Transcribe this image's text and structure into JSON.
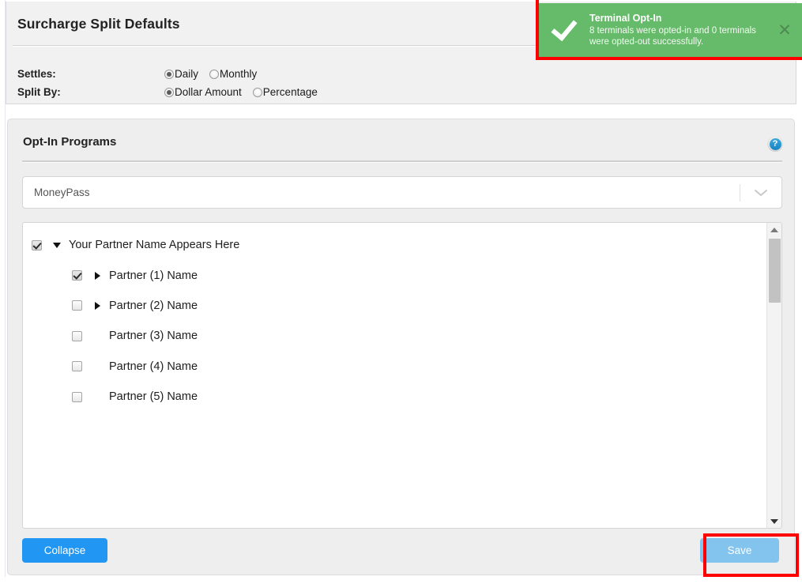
{
  "header": {
    "title": "Surcharge Split Defaults",
    "rows": [
      {
        "label": "Settles:",
        "options": [
          {
            "label": "Daily",
            "checked": true
          },
          {
            "label": "Monthly",
            "checked": false
          }
        ]
      },
      {
        "label": "Split By:",
        "options": [
          {
            "label": "Dollar Amount",
            "checked": true
          },
          {
            "label": "Percentage",
            "checked": false
          }
        ]
      }
    ]
  },
  "card": {
    "title": "Opt-In Programs",
    "help_icon": "help-circle-icon",
    "help_glyph": "?",
    "program_select": {
      "value": "MoneyPass",
      "caret_icon": "chevron-down-icon"
    },
    "tree": [
      {
        "label": "Your Partner Name Appears Here",
        "level": 0,
        "checked": true,
        "arrow": "down",
        "arrow_icon": "triangle-down-icon"
      },
      {
        "label": "Partner (1) Name",
        "level": 1,
        "checked": true,
        "arrow": "right",
        "arrow_icon": "triangle-right-icon"
      },
      {
        "label": "Partner (2) Name",
        "level": 1,
        "checked": false,
        "arrow": "right",
        "arrow_icon": "triangle-right-icon"
      },
      {
        "label": "Partner (3) Name",
        "level": 1,
        "checked": false,
        "arrow": "none",
        "arrow_icon": ""
      },
      {
        "label": "Partner (4) Name",
        "level": 1,
        "checked": false,
        "arrow": "none",
        "arrow_icon": ""
      },
      {
        "label": "Partner (5) Name",
        "level": 1,
        "checked": false,
        "arrow": "none",
        "arrow_icon": ""
      }
    ],
    "scrollbar": {
      "up_icon": "scroll-up-arrow-icon",
      "down_icon": "scroll-down-arrow-icon"
    },
    "buttons": {
      "collapse": "Collapse",
      "save": "Save"
    }
  },
  "toast": {
    "icon": "check-mark-icon",
    "title": "Terminal Opt-In",
    "message": "8 terminals were opted-in and 0 terminals were opted-out successfully.",
    "close_icon": "close-icon",
    "close_glyph": "✕"
  },
  "colors": {
    "toast_green": "#66bb6a",
    "primary_blue": "#2196f3",
    "save_blue": "#82c4ee",
    "annotation_red": "#ff0000",
    "panel_grey": "#eeeeee"
  }
}
